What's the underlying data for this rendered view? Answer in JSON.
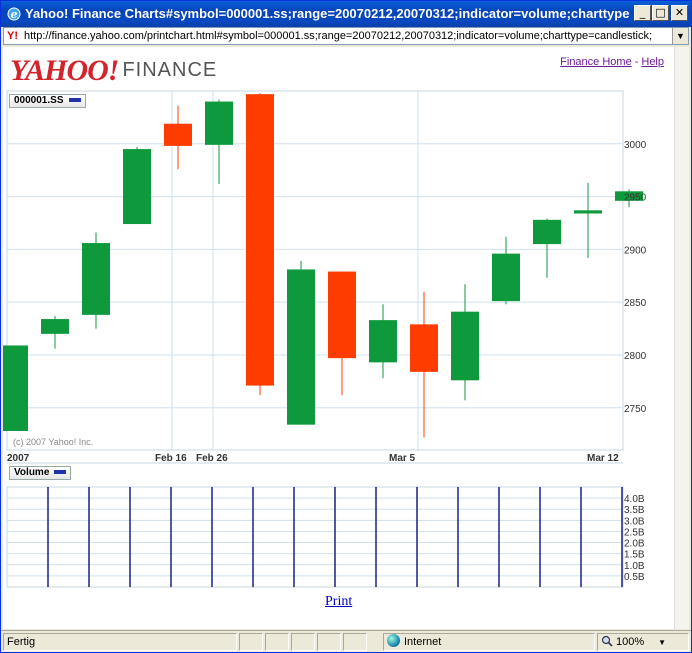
{
  "window": {
    "title": "Yahoo! Finance Charts#symbol=000001.ss;range=20070212,20070312;indicator=volume;charttype=cand...",
    "minimize": "_",
    "maximize": "□",
    "close": "✕"
  },
  "address": {
    "url": "http://finance.yahoo.com/printchart.html#symbol=000001.ss;range=20070212,20070312;indicator=volume;charttype=candlestick;"
  },
  "header": {
    "logo_yahoo": "YAHOO!",
    "logo_finance": "FINANCE",
    "finance_home": "Finance Home",
    "separator": "-",
    "help": "Help"
  },
  "price_legend": "000001.SS",
  "volume_legend": "Volume",
  "copyright": "(c) 2007 Yahoo! Inc.",
  "print_label": "Print",
  "status": {
    "text": "Fertig",
    "zone": "Internet",
    "zoom": "100%"
  },
  "colors": {
    "up": "#0e9a3c",
    "down": "#ff3c00",
    "grid": "#cfe0ee",
    "volume_bar": "#1a237e"
  },
  "chart_data": [
    {
      "type": "candlestick",
      "symbol": "000001.SS",
      "ylim": [
        2710,
        3050
      ],
      "y_ticks": [
        2750,
        2800,
        2850,
        2900,
        2950,
        3000
      ],
      "x_tick_labels": [
        "2007",
        "Feb 16",
        "Feb 26",
        "Mar 5",
        "Mar 12"
      ],
      "candles": [
        {
          "open": 2728,
          "high": 2809,
          "low": 2728,
          "close": 2809
        },
        {
          "open": 2820,
          "high": 2837,
          "low": 2806,
          "close": 2834
        },
        {
          "open": 2838,
          "high": 2916,
          "low": 2825,
          "close": 2906
        },
        {
          "open": 2924,
          "high": 2997,
          "low": 2924,
          "close": 2995
        },
        {
          "open": 3019,
          "high": 3036,
          "low": 2976,
          "close": 2998
        },
        {
          "open": 2999,
          "high": 3042,
          "low": 2962,
          "close": 3040
        },
        {
          "open": 3047,
          "high": 3048,
          "low": 2762,
          "close": 2771
        },
        {
          "open": 2734,
          "high": 2889,
          "low": 2734,
          "close": 2881
        },
        {
          "open": 2879,
          "high": 2879,
          "low": 2762,
          "close": 2797
        },
        {
          "open": 2793,
          "high": 2848,
          "low": 2778,
          "close": 2833
        },
        {
          "open": 2829,
          "high": 2860,
          "low": 2722,
          "close": 2784
        },
        {
          "open": 2776,
          "high": 2867,
          "low": 2757,
          "close": 2841
        },
        {
          "open": 2851,
          "high": 2912,
          "low": 2848,
          "close": 2896
        },
        {
          "open": 2905,
          "high": 2929,
          "low": 2873,
          "close": 2928
        },
        {
          "open": 2934,
          "high": 2963,
          "low": 2892,
          "close": 2937
        },
        {
          "open": 2946,
          "high": 2957,
          "low": 2940,
          "close": 2955
        }
      ]
    },
    {
      "type": "bar",
      "title": "Volume",
      "y_tick_labels": [
        "4.0B",
        "3.5B",
        "3.0B",
        "2.5B",
        "2.0B",
        "1.5B",
        "1.0B",
        "0.5B"
      ],
      "ylim": [
        0,
        4.5
      ],
      "values": [
        4.5,
        4.5,
        4.5,
        4.5,
        4.5,
        4.5,
        4.5,
        4.5,
        4.5,
        4.5,
        4.5,
        4.5,
        4.5,
        4.5,
        4.5
      ]
    }
  ]
}
